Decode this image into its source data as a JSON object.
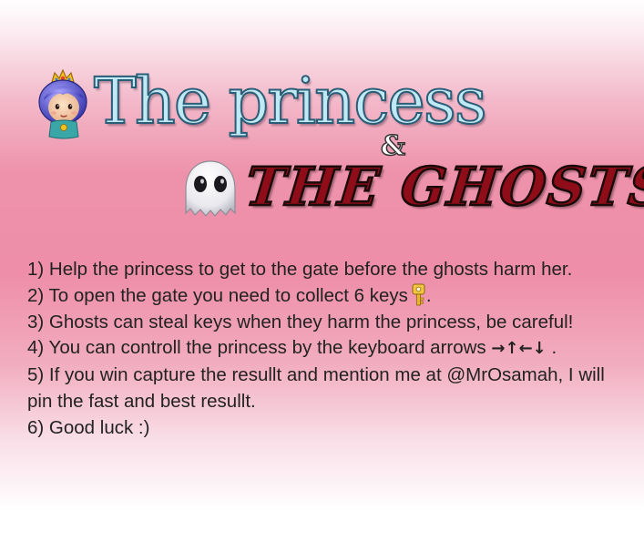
{
  "title": {
    "line1": "The princess",
    "amp": "&",
    "line2": "THE GHOSTS"
  },
  "icons": {
    "princess": "princess-avatar-icon",
    "ghost": "ghost-icon",
    "key": "key-icon"
  },
  "instructions": {
    "step1": "1) Help the princess to get to the gate before the ghosts harm her.",
    "step2_before": "2) To open the gate you need to collect 6 keys",
    "step2_after": ".",
    "step3": "3) Ghosts can steal keys when they harm the princess, be careful!",
    "step4_before": "4) You can controll the princess by the keyboard arrows",
    "arrows": [
      "→",
      "↑",
      "←",
      "↓"
    ],
    "step4_after": ".",
    "step5": "5) If you win capture the resullt and mention me at @MrOsamah, I will pin the fast and best resullt.",
    "step6": "6) Good luck :)"
  },
  "colors": {
    "title_princess_fill": "#bfe9f4",
    "title_princess_stroke": "#2c5d76",
    "title_ghosts_fill": "#8e0d18",
    "text": "#222222"
  }
}
